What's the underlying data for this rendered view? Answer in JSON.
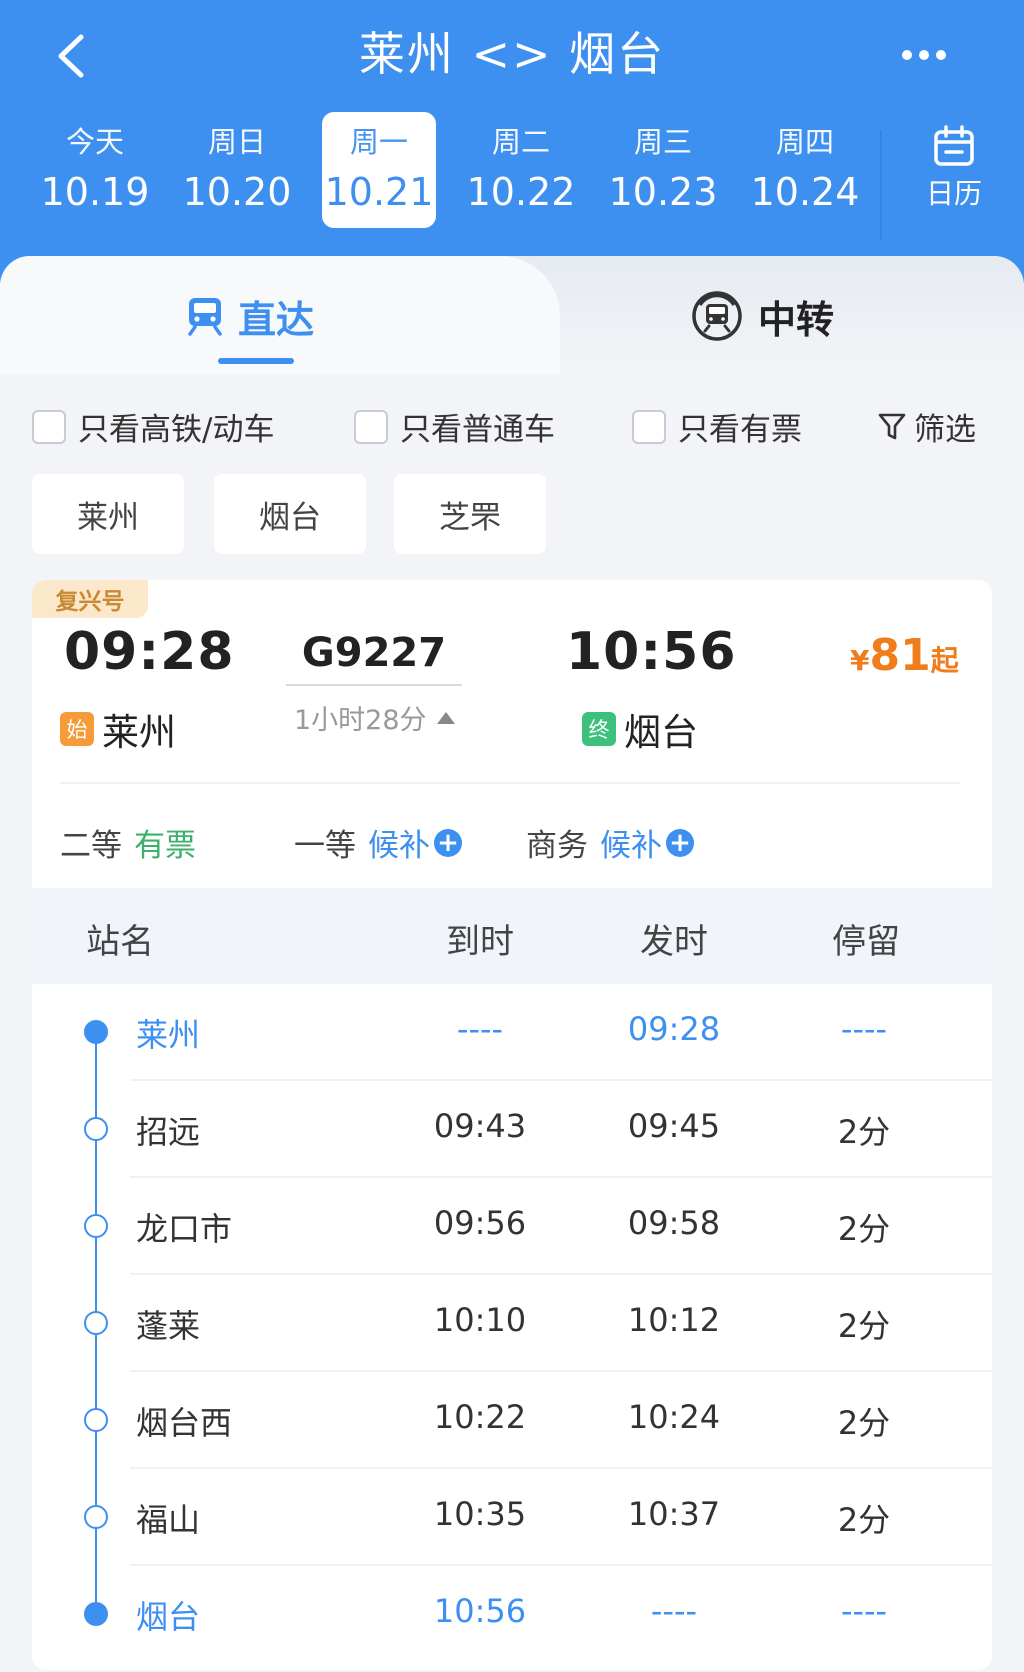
{
  "header": {
    "title": "莱州 <> 烟台",
    "back_icon": "chevron-left-icon",
    "more_icon": "more-horizontal-icon"
  },
  "dates": [
    {
      "dow": "今天",
      "day": "10.19",
      "active": false
    },
    {
      "dow": "周日",
      "day": "10.20",
      "active": false
    },
    {
      "dow": "周一",
      "day": "10.21",
      "active": true
    },
    {
      "dow": "周二",
      "day": "10.22",
      "active": false
    },
    {
      "dow": "周三",
      "day": "10.23",
      "active": false
    },
    {
      "dow": "周四",
      "day": "10.24",
      "active": false
    }
  ],
  "calendar": {
    "label": "日历",
    "icon": "calendar-icon"
  },
  "tabs": {
    "direct": "直达",
    "transfer": "中转"
  },
  "filters": {
    "high_speed": "只看高铁/动车",
    "normal": "只看普通车",
    "available": "只看有票",
    "filter": "筛选"
  },
  "station_chips": [
    "莱州",
    "烟台",
    "芝罘"
  ],
  "train": {
    "badge": "复兴号",
    "number": "G9227",
    "dep_time": "09:28",
    "arr_time": "10:56",
    "duration": "1小时28分",
    "from_tag": "始",
    "from": "莱州",
    "to_tag": "终",
    "to": "烟台",
    "price_symbol": "¥",
    "price": "81",
    "price_suffix": "起",
    "seats": [
      {
        "class": "二等",
        "status": "有票",
        "plus": false
      },
      {
        "class": "一等",
        "status": "候补",
        "plus": true
      },
      {
        "class": "商务",
        "status": "候补",
        "plus": true
      }
    ]
  },
  "stops_table": {
    "headers": {
      "name": "站名",
      "arrive": "到时",
      "depart": "发时",
      "stay": "停留"
    },
    "rows": [
      {
        "name": "莱州",
        "arrive": "----",
        "depart": "09:28",
        "stay": "----"
      },
      {
        "name": "招远",
        "arrive": "09:43",
        "depart": "09:45",
        "stay": "2分"
      },
      {
        "name": "龙口市",
        "arrive": "09:56",
        "depart": "09:58",
        "stay": "2分"
      },
      {
        "name": "蓬莱",
        "arrive": "10:10",
        "depart": "10:12",
        "stay": "2分"
      },
      {
        "name": "烟台西",
        "arrive": "10:22",
        "depart": "10:24",
        "stay": "2分"
      },
      {
        "name": "福山",
        "arrive": "10:35",
        "depart": "10:37",
        "stay": "2分"
      },
      {
        "name": "烟台",
        "arrive": "10:56",
        "depart": "----",
        "stay": "----"
      }
    ]
  },
  "colors": {
    "primary": "#3d8ff0",
    "price": "#f07c1c",
    "available": "#3cb06a",
    "badge_bg": "#fbe7c9"
  }
}
